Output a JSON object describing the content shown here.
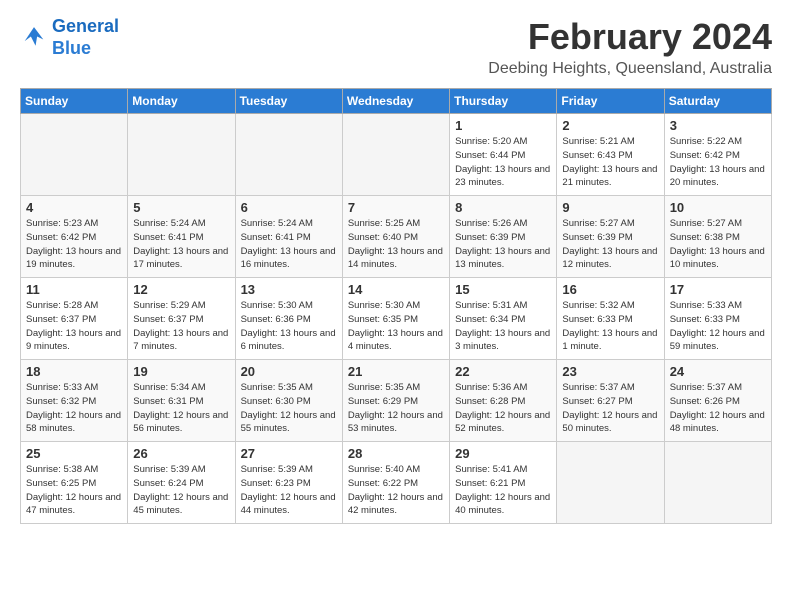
{
  "logo": {
    "line1": "General",
    "line2": "Blue"
  },
  "title": "February 2024",
  "location": "Deebing Heights, Queensland, Australia",
  "days_of_week": [
    "Sunday",
    "Monday",
    "Tuesday",
    "Wednesday",
    "Thursday",
    "Friday",
    "Saturday"
  ],
  "weeks": [
    [
      {
        "num": "",
        "sunrise": "",
        "sunset": "",
        "daylight": "",
        "empty": true
      },
      {
        "num": "",
        "sunrise": "",
        "sunset": "",
        "daylight": "",
        "empty": true
      },
      {
        "num": "",
        "sunrise": "",
        "sunset": "",
        "daylight": "",
        "empty": true
      },
      {
        "num": "",
        "sunrise": "",
        "sunset": "",
        "daylight": "",
        "empty": true
      },
      {
        "num": "1",
        "sunrise": "Sunrise: 5:20 AM",
        "sunset": "Sunset: 6:44 PM",
        "daylight": "Daylight: 13 hours and 23 minutes.",
        "empty": false
      },
      {
        "num": "2",
        "sunrise": "Sunrise: 5:21 AM",
        "sunset": "Sunset: 6:43 PM",
        "daylight": "Daylight: 13 hours and 21 minutes.",
        "empty": false
      },
      {
        "num": "3",
        "sunrise": "Sunrise: 5:22 AM",
        "sunset": "Sunset: 6:42 PM",
        "daylight": "Daylight: 13 hours and 20 minutes.",
        "empty": false
      }
    ],
    [
      {
        "num": "4",
        "sunrise": "Sunrise: 5:23 AM",
        "sunset": "Sunset: 6:42 PM",
        "daylight": "Daylight: 13 hours and 19 minutes.",
        "empty": false
      },
      {
        "num": "5",
        "sunrise": "Sunrise: 5:24 AM",
        "sunset": "Sunset: 6:41 PM",
        "daylight": "Daylight: 13 hours and 17 minutes.",
        "empty": false
      },
      {
        "num": "6",
        "sunrise": "Sunrise: 5:24 AM",
        "sunset": "Sunset: 6:41 PM",
        "daylight": "Daylight: 13 hours and 16 minutes.",
        "empty": false
      },
      {
        "num": "7",
        "sunrise": "Sunrise: 5:25 AM",
        "sunset": "Sunset: 6:40 PM",
        "daylight": "Daylight: 13 hours and 14 minutes.",
        "empty": false
      },
      {
        "num": "8",
        "sunrise": "Sunrise: 5:26 AM",
        "sunset": "Sunset: 6:39 PM",
        "daylight": "Daylight: 13 hours and 13 minutes.",
        "empty": false
      },
      {
        "num": "9",
        "sunrise": "Sunrise: 5:27 AM",
        "sunset": "Sunset: 6:39 PM",
        "daylight": "Daylight: 13 hours and 12 minutes.",
        "empty": false
      },
      {
        "num": "10",
        "sunrise": "Sunrise: 5:27 AM",
        "sunset": "Sunset: 6:38 PM",
        "daylight": "Daylight: 13 hours and 10 minutes.",
        "empty": false
      }
    ],
    [
      {
        "num": "11",
        "sunrise": "Sunrise: 5:28 AM",
        "sunset": "Sunset: 6:37 PM",
        "daylight": "Daylight: 13 hours and 9 minutes.",
        "empty": false
      },
      {
        "num": "12",
        "sunrise": "Sunrise: 5:29 AM",
        "sunset": "Sunset: 6:37 PM",
        "daylight": "Daylight: 13 hours and 7 minutes.",
        "empty": false
      },
      {
        "num": "13",
        "sunrise": "Sunrise: 5:30 AM",
        "sunset": "Sunset: 6:36 PM",
        "daylight": "Daylight: 13 hours and 6 minutes.",
        "empty": false
      },
      {
        "num": "14",
        "sunrise": "Sunrise: 5:30 AM",
        "sunset": "Sunset: 6:35 PM",
        "daylight": "Daylight: 13 hours and 4 minutes.",
        "empty": false
      },
      {
        "num": "15",
        "sunrise": "Sunrise: 5:31 AM",
        "sunset": "Sunset: 6:34 PM",
        "daylight": "Daylight: 13 hours and 3 minutes.",
        "empty": false
      },
      {
        "num": "16",
        "sunrise": "Sunrise: 5:32 AM",
        "sunset": "Sunset: 6:33 PM",
        "daylight": "Daylight: 13 hours and 1 minute.",
        "empty": false
      },
      {
        "num": "17",
        "sunrise": "Sunrise: 5:33 AM",
        "sunset": "Sunset: 6:33 PM",
        "daylight": "Daylight: 12 hours and 59 minutes.",
        "empty": false
      }
    ],
    [
      {
        "num": "18",
        "sunrise": "Sunrise: 5:33 AM",
        "sunset": "Sunset: 6:32 PM",
        "daylight": "Daylight: 12 hours and 58 minutes.",
        "empty": false
      },
      {
        "num": "19",
        "sunrise": "Sunrise: 5:34 AM",
        "sunset": "Sunset: 6:31 PM",
        "daylight": "Daylight: 12 hours and 56 minutes.",
        "empty": false
      },
      {
        "num": "20",
        "sunrise": "Sunrise: 5:35 AM",
        "sunset": "Sunset: 6:30 PM",
        "daylight": "Daylight: 12 hours and 55 minutes.",
        "empty": false
      },
      {
        "num": "21",
        "sunrise": "Sunrise: 5:35 AM",
        "sunset": "Sunset: 6:29 PM",
        "daylight": "Daylight: 12 hours and 53 minutes.",
        "empty": false
      },
      {
        "num": "22",
        "sunrise": "Sunrise: 5:36 AM",
        "sunset": "Sunset: 6:28 PM",
        "daylight": "Daylight: 12 hours and 52 minutes.",
        "empty": false
      },
      {
        "num": "23",
        "sunrise": "Sunrise: 5:37 AM",
        "sunset": "Sunset: 6:27 PM",
        "daylight": "Daylight: 12 hours and 50 minutes.",
        "empty": false
      },
      {
        "num": "24",
        "sunrise": "Sunrise: 5:37 AM",
        "sunset": "Sunset: 6:26 PM",
        "daylight": "Daylight: 12 hours and 48 minutes.",
        "empty": false
      }
    ],
    [
      {
        "num": "25",
        "sunrise": "Sunrise: 5:38 AM",
        "sunset": "Sunset: 6:25 PM",
        "daylight": "Daylight: 12 hours and 47 minutes.",
        "empty": false
      },
      {
        "num": "26",
        "sunrise": "Sunrise: 5:39 AM",
        "sunset": "Sunset: 6:24 PM",
        "daylight": "Daylight: 12 hours and 45 minutes.",
        "empty": false
      },
      {
        "num": "27",
        "sunrise": "Sunrise: 5:39 AM",
        "sunset": "Sunset: 6:23 PM",
        "daylight": "Daylight: 12 hours and 44 minutes.",
        "empty": false
      },
      {
        "num": "28",
        "sunrise": "Sunrise: 5:40 AM",
        "sunset": "Sunset: 6:22 PM",
        "daylight": "Daylight: 12 hours and 42 minutes.",
        "empty": false
      },
      {
        "num": "29",
        "sunrise": "Sunrise: 5:41 AM",
        "sunset": "Sunset: 6:21 PM",
        "daylight": "Daylight: 12 hours and 40 minutes.",
        "empty": false
      },
      {
        "num": "",
        "sunrise": "",
        "sunset": "",
        "daylight": "",
        "empty": true
      },
      {
        "num": "",
        "sunrise": "",
        "sunset": "",
        "daylight": "",
        "empty": true
      }
    ]
  ]
}
